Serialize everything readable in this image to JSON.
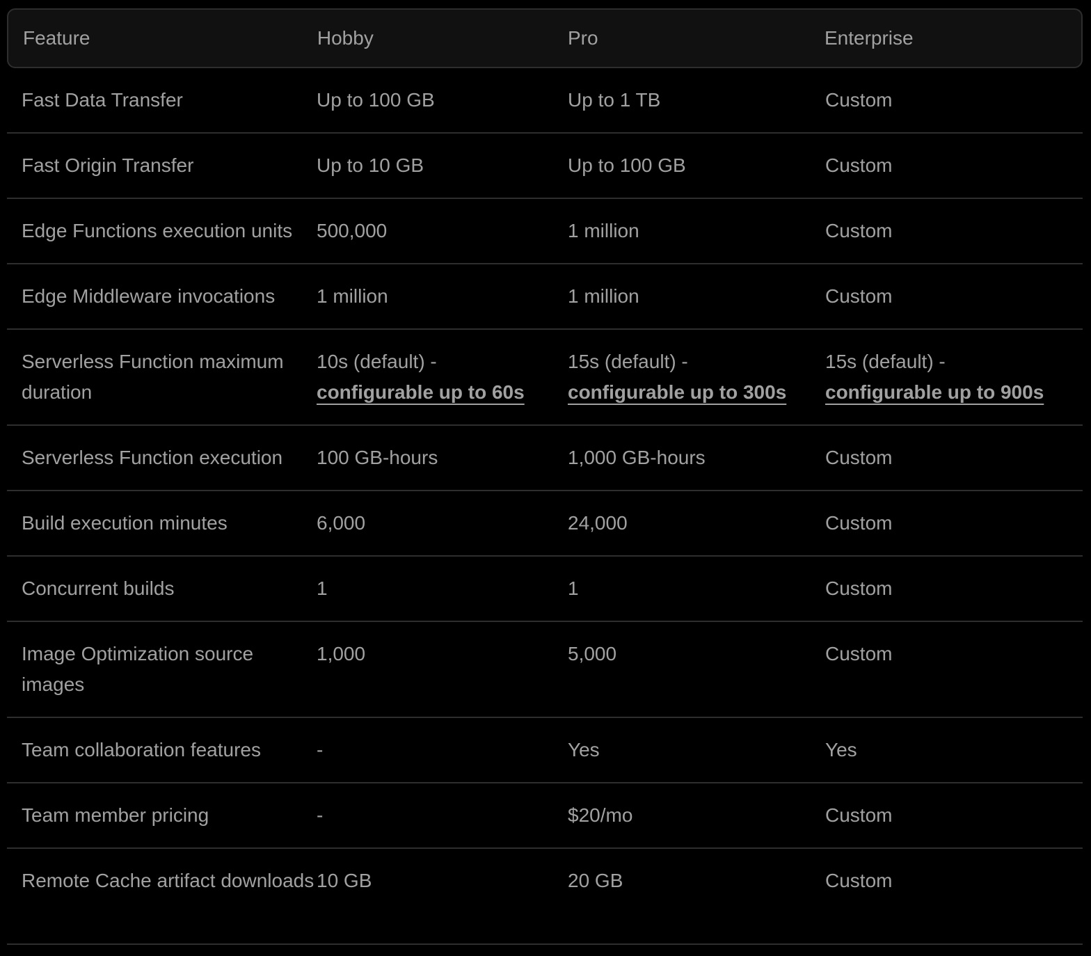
{
  "header": {
    "feature": "Feature",
    "hobby": "Hobby",
    "pro": "Pro",
    "enterprise": "Enterprise"
  },
  "rows": [
    {
      "feature": "Fast Data Transfer",
      "hobby": "Up to 100 GB",
      "pro": "Up to 1 TB",
      "enterprise": "Custom"
    },
    {
      "feature": "Fast Origin Transfer",
      "hobby": "Up to 10 GB",
      "pro": "Up to 100 GB",
      "enterprise": "Custom"
    },
    {
      "feature": "Edge Functions execution units",
      "hobby": "500,000",
      "pro": "1 million",
      "enterprise": "Custom"
    },
    {
      "feature": "Edge Middleware invocations",
      "hobby": "1 million",
      "pro": "1 million",
      "enterprise": "Custom"
    },
    {
      "feature": "Serverless Function maximum duration",
      "hobby": "10s (default) -",
      "hobby_link": "configurable up to 60s",
      "pro": "15s (default) -",
      "pro_link": "configurable up to 300s",
      "enterprise": "15s (default) -",
      "enterprise_link": "configurable up to 900s"
    },
    {
      "feature": "Serverless Function execution",
      "hobby": "100 GB-hours",
      "pro": "1,000 GB-hours",
      "enterprise": "Custom"
    },
    {
      "feature": "Build execution minutes",
      "hobby": "6,000",
      "pro": "24,000",
      "enterprise": "Custom"
    },
    {
      "feature": "Concurrent builds",
      "hobby": "1",
      "pro": "1",
      "enterprise": "Custom"
    },
    {
      "feature": "Image Optimization source images",
      "hobby": "1,000",
      "pro": "5,000",
      "enterprise": "Custom"
    },
    {
      "feature": "Team collaboration features",
      "hobby": "-",
      "pro": "Yes",
      "enterprise": "Yes"
    },
    {
      "feature": "Team member pricing",
      "hobby": "-",
      "pro": "$20/mo",
      "enterprise": "Custom"
    },
    {
      "feature": "Remote Cache artifact downloads",
      "hobby": "10 GB",
      "pro": "20 GB",
      "enterprise": "Custom"
    }
  ]
}
